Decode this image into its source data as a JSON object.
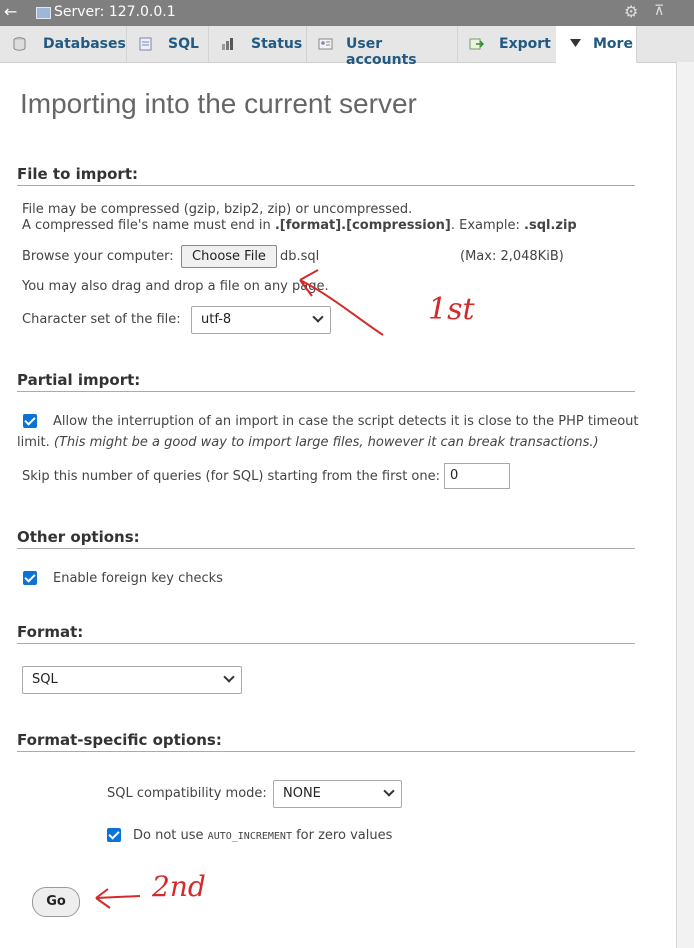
{
  "titlebar": {
    "back": "←",
    "title": "Server: 127.0.0.1",
    "gear": "⚙",
    "collapse": "⊼"
  },
  "tabs": [
    {
      "label": "Databases",
      "icon": "database-icon"
    },
    {
      "label": "SQL",
      "icon": "sql-icon"
    },
    {
      "label": "Status",
      "icon": "status-icon"
    },
    {
      "label": "User accounts",
      "icon": "user-accounts-icon"
    },
    {
      "label": "Export",
      "icon": "export-icon"
    },
    {
      "label": "More",
      "icon": "triangle-down-icon"
    }
  ],
  "page_title": "Importing into the current server",
  "file_import": {
    "heading": "File to import:",
    "line1": "File may be compressed (gzip, bzip2, zip) or uncompressed.",
    "line2_pre": "A compressed file's name must end in ",
    "line2_bold": ".[format].[compression]",
    "line2_mid": ". Example: ",
    "line2_example": ".sql.zip",
    "browse_label": "Browse your computer:",
    "choose_file": "Choose File",
    "file_name": "db.sql",
    "max_size": "(Max: 2,048KiB)",
    "drag_drop": "You may also drag and drop a file on any page.",
    "charset_label": "Character set of the file:",
    "charset_value": "utf-8"
  },
  "partial_import": {
    "heading": "Partial import:",
    "allow_interruption_text": "Allow the interruption of an import in case the script detects it is close to the PHP timeout",
    "allow_interruption_text2": "limit.",
    "allow_interruption_note": "(This might be a good way to import large files, however it can break transactions.)",
    "skip_label": "Skip this number of queries (for SQL) starting from the first one:",
    "skip_value": "0"
  },
  "other_options": {
    "heading": "Other options:",
    "foreign_key_label": "Enable foreign key checks"
  },
  "format": {
    "heading": "Format:",
    "value": "SQL"
  },
  "format_specific": {
    "heading": "Format-specific options:",
    "compat_label": "SQL compatibility mode:",
    "compat_value": "NONE",
    "auto_inc_pre": "Do not use ",
    "auto_inc_code": "AUTO_INCREMENT",
    "auto_inc_post": " for zero values"
  },
  "go_button": "Go",
  "annotations": {
    "first": "1st",
    "second": "2nd",
    "color": "#d32a2a"
  }
}
